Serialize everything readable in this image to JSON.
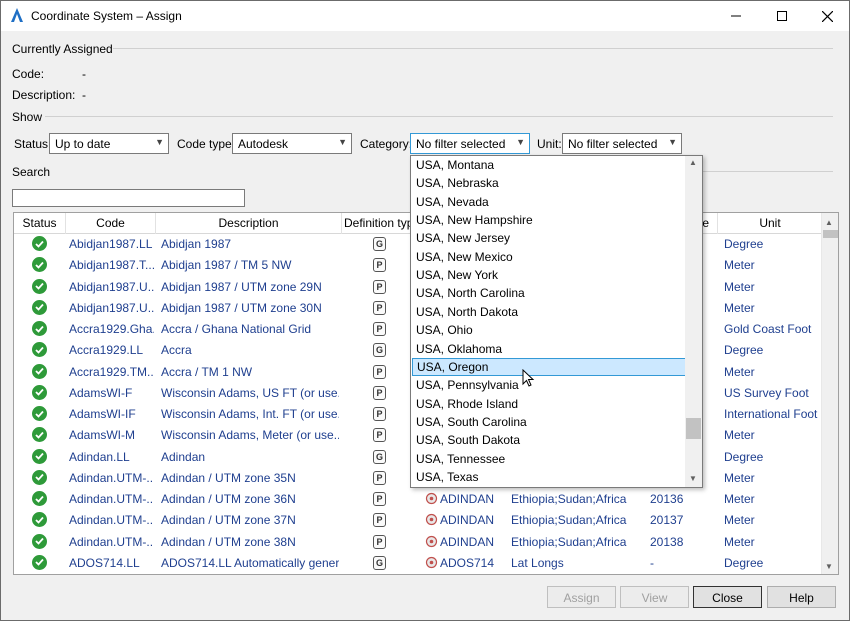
{
  "window": {
    "title": "Coordinate System – Assign",
    "minimize_icon": "minimize-icon",
    "maximize_icon": "maximize-icon",
    "close_icon": "close-icon"
  },
  "currently_assigned": {
    "heading": "Currently Assigned",
    "code_label": "Code:",
    "code_value": "-",
    "description_label": "Description:",
    "description_value": "-"
  },
  "show": {
    "heading": "Show",
    "status_label": "Status:",
    "status_value": "Up to date",
    "code_type_label": "Code type:",
    "code_type_value": "Autodesk",
    "category_label": "Category:",
    "category_value": "No filter selected",
    "unit_label": "Unit:",
    "unit_value": "No filter selected"
  },
  "search": {
    "heading": "Search",
    "value": ""
  },
  "grid": {
    "columns": [
      "Status",
      "Code",
      "Description",
      "Definition typ",
      "",
      "",
      "e",
      "Unit"
    ],
    "rows": [
      {
        "code": "Abidjan1987.LL",
        "description": "Abidjan 1987",
        "def": "G",
        "datum": "",
        "region": "",
        "epsg": "",
        "unit": "Degree"
      },
      {
        "code": "Abidjan1987.T...",
        "description": "Abidjan 1987 / TM 5 NW",
        "def": "P",
        "datum": "",
        "region": "",
        "epsg": "",
        "unit": "Meter"
      },
      {
        "code": "Abidjan1987.U...",
        "description": "Abidjan 1987 / UTM zone 29N",
        "def": "P",
        "datum": "",
        "region": "",
        "epsg": "",
        "unit": "Meter"
      },
      {
        "code": "Abidjan1987.U...",
        "description": "Abidjan 1987 / UTM zone 30N",
        "def": "P",
        "datum": "",
        "region": "",
        "epsg": "",
        "unit": "Meter"
      },
      {
        "code": "Accra1929.Gha...",
        "description": "Accra / Ghana National Grid",
        "def": "P",
        "datum": "",
        "region": "",
        "epsg": "",
        "unit": "Gold Coast Foot"
      },
      {
        "code": "Accra1929.LL",
        "description": "Accra",
        "def": "G",
        "datum": "",
        "region": "",
        "epsg": "",
        "unit": "Degree"
      },
      {
        "code": "Accra1929.TM...",
        "description": "Accra / TM 1 NW",
        "def": "P",
        "datum": "",
        "region": "",
        "epsg": "",
        "unit": "Meter"
      },
      {
        "code": "AdamsWI-F",
        "description": "Wisconsin Adams, US FT (or use...",
        "def": "P",
        "datum": "",
        "region": "",
        "epsg": "",
        "unit": "US Survey Foot"
      },
      {
        "code": "AdamsWI-IF",
        "description": "Wisconsin Adams, Int. FT (or use...",
        "def": "P",
        "datum": "",
        "region": "",
        "epsg": "",
        "unit": "International Foot"
      },
      {
        "code": "AdamsWI-M",
        "description": "Wisconsin Adams, Meter (or use...",
        "def": "P",
        "datum": "",
        "region": "",
        "epsg": "",
        "unit": "Meter"
      },
      {
        "code": "Adindan.LL",
        "description": "Adindan",
        "def": "G",
        "datum": "",
        "region": "",
        "epsg": "",
        "unit": "Degree"
      },
      {
        "code": "Adindan.UTM-...",
        "description": "Adindan / UTM zone 35N",
        "def": "P",
        "datum": "",
        "region": "",
        "epsg": "",
        "unit": "Meter"
      },
      {
        "code": "Adindan.UTM-...",
        "description": "Adindan / UTM zone 36N",
        "def": "P",
        "datum": "ADINDAN",
        "region": "Ethiopia;Sudan;Africa",
        "epsg": "20136",
        "unit": "Meter"
      },
      {
        "code": "Adindan.UTM-...",
        "description": "Adindan / UTM zone 37N",
        "def": "P",
        "datum": "ADINDAN",
        "region": "Ethiopia;Sudan;Africa",
        "epsg": "20137",
        "unit": "Meter"
      },
      {
        "code": "Adindan.UTM-...",
        "description": "Adindan / UTM zone 38N",
        "def": "P",
        "datum": "ADINDAN",
        "region": "Ethiopia;Sudan;Africa",
        "epsg": "20138",
        "unit": "Meter"
      },
      {
        "code": "ADOS714.LL",
        "description": "ADOS714.LL Automatically gener...",
        "def": "G",
        "datum": "ADOS714",
        "region": "Lat Longs",
        "epsg": "-",
        "unit": "Degree"
      }
    ]
  },
  "category_dropdown": {
    "items": [
      "USA, Montana",
      "USA, Nebraska",
      "USA, Nevada",
      "USA, New Hampshire",
      "USA, New Jersey",
      "USA, New Mexico",
      "USA, New York",
      "USA, North Carolina",
      "USA, North Dakota",
      "USA, Ohio",
      "USA, Oklahoma",
      "USA, Oregon",
      "USA, Pennsylvania",
      "USA, Rhode Island",
      "USA, South Carolina",
      "USA, South Dakota",
      "USA, Tennessee",
      "USA, Texas"
    ],
    "selected_index": 11
  },
  "buttons": {
    "assign": "Assign",
    "view": "View",
    "close": "Close",
    "help": "Help"
  },
  "colors": {
    "link_text": "#1f3f8f",
    "status_ok": "#2e9a39",
    "selection": "#cce8ff"
  }
}
